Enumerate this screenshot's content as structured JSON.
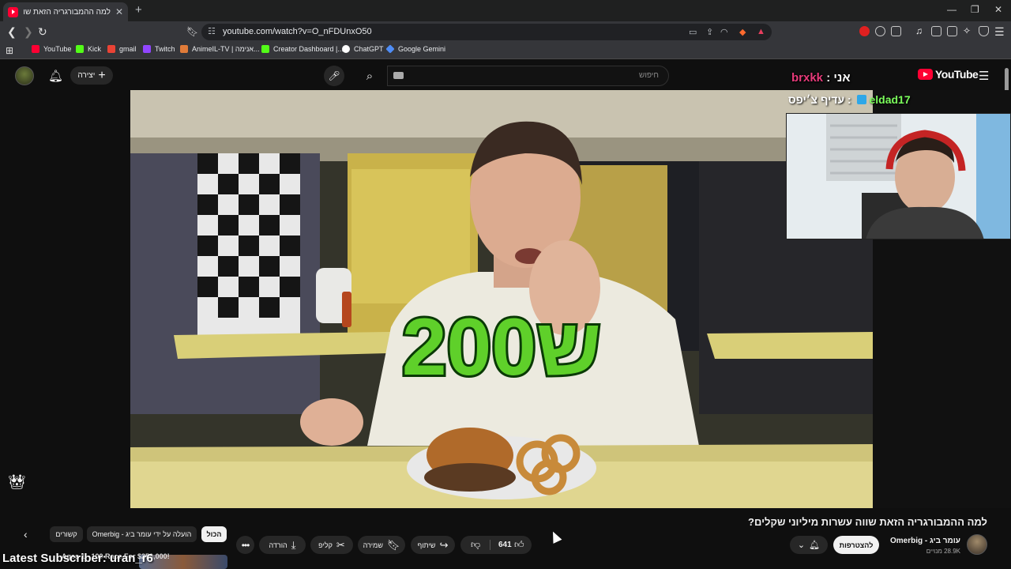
{
  "browser": {
    "tab_title": "למה ההמבורגריה הזאת שווה ע...",
    "new_tab": "+",
    "url": "youtube.com/watch?v=O_nFDUnxO50",
    "window_controls": [
      "—",
      "❐",
      "✕"
    ]
  },
  "bookmarks": [
    {
      "label": "YouTube",
      "color": "#ff0033"
    },
    {
      "label": "Kick",
      "color": "#53fc18"
    },
    {
      "label": "gmail",
      "color": "#ea4335"
    },
    {
      "label": "Twitch",
      "color": "#9146ff"
    },
    {
      "label": "AnimeIL-TV | אנימה...",
      "color": "#e07b39"
    },
    {
      "label": "Creator Dashboard |...",
      "color": "#53fc18"
    },
    {
      "label": "ChatGPT",
      "color": "#ffffff"
    },
    {
      "label": "Google Gemini",
      "color": "#4f8df5"
    }
  ],
  "youtube": {
    "create_label": "יצירה",
    "search_placeholder": "חיפוש",
    "logo_text": "YouTube"
  },
  "overlay": {
    "me_label": "אני :",
    "nick": "brxkk",
    "chat_user": "eldad17",
    "chat_message": ": עדיף צ׳יפס"
  },
  "video": {
    "caption": "200ש",
    "title": "למה ההמבורגריה הזאת שווה עשרות מיליוני שקלים?",
    "channel_name": "עומר ביג - Omerbig",
    "channel_subs": "28.9K מנויים",
    "join_label": "להצטרפות",
    "like_count": "641",
    "share_label": "שיתוף",
    "save_label": "שמירה",
    "clip_label": "קליפ",
    "download_label": "הורדה"
  },
  "chips": {
    "all": "הכול",
    "uploaded_by": "הועלה על ידי עומר ביג - Omerbig",
    "related": "קשורים"
  },
  "stream": {
    "latest_subscriber": "Latest Subscriber: uran_r6",
    "thumb_text": "Ages 1 - 100 Race For $250,000!"
  }
}
